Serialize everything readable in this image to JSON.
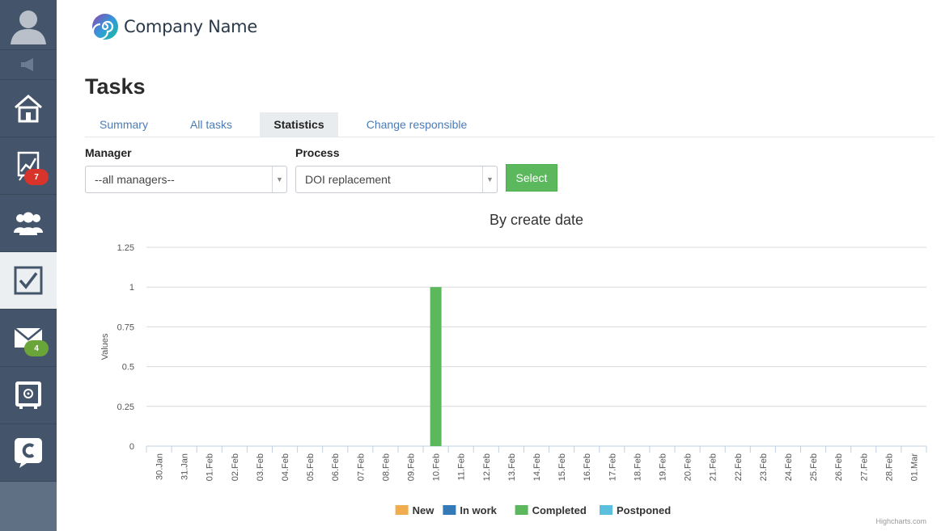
{
  "sidebar": {
    "items": [
      {
        "name": "profile",
        "icon": "user-avatar-icon"
      },
      {
        "name": "announcements",
        "icon": "megaphone-icon"
      },
      {
        "name": "home",
        "icon": "home-icon"
      },
      {
        "name": "sales",
        "icon": "chart-growth-icon",
        "badge": "7",
        "badge_color": "#d9342b"
      },
      {
        "name": "clients",
        "icon": "users-group-icon"
      },
      {
        "name": "tasks",
        "icon": "checkbox-icon",
        "active": true
      },
      {
        "name": "mail",
        "icon": "envelope-icon",
        "badge": "4",
        "badge_color": "#6aa53a"
      },
      {
        "name": "safe",
        "icon": "safe-icon"
      },
      {
        "name": "chat",
        "icon": "chat-c-icon"
      }
    ]
  },
  "header": {
    "company_name": "Company Name",
    "logo_icon": "spiral-logo-icon"
  },
  "page": {
    "title": "Tasks"
  },
  "tabs": [
    {
      "label": "Summary"
    },
    {
      "label": "All tasks"
    },
    {
      "label": "Statistics",
      "active": true
    },
    {
      "label": "Change responsible"
    }
  ],
  "filters": {
    "manager_label": "Manager",
    "manager_value": "--all managers--",
    "process_label": "Process",
    "process_value": "DOI replacement",
    "select_button": "Select"
  },
  "chart_data": {
    "type": "bar",
    "title": "By create date",
    "ylabel": "Values",
    "xlabel": "",
    "ylim": [
      0,
      1.25
    ],
    "yticks": [
      "0",
      "0.25",
      "0.5",
      "0.75",
      "1",
      "1.25"
    ],
    "categories": [
      "30.Jan",
      "31.Jan",
      "01.Feb",
      "02.Feb",
      "03.Feb",
      "04.Feb",
      "05.Feb",
      "06.Feb",
      "07.Feb",
      "08.Feb",
      "09.Feb",
      "10.Feb",
      "11.Feb",
      "12.Feb",
      "13.Feb",
      "14.Feb",
      "15.Feb",
      "16.Feb",
      "17.Feb",
      "18.Feb",
      "19.Feb",
      "20.Feb",
      "21.Feb",
      "22.Feb",
      "23.Feb",
      "24.Feb",
      "25.Feb",
      "26.Feb",
      "27.Feb",
      "28.Feb",
      "01.Mar"
    ],
    "series": [
      {
        "name": "New",
        "color": "#f0ad4e",
        "values": [
          0,
          0,
          0,
          0,
          0,
          0,
          0,
          0,
          0,
          0,
          0,
          0,
          0,
          0,
          0,
          0,
          0,
          0,
          0,
          0,
          0,
          0,
          0,
          0,
          0,
          0,
          0,
          0,
          0,
          0,
          0
        ]
      },
      {
        "name": "In work",
        "color": "#337ab7",
        "values": [
          0,
          0,
          0,
          0,
          0,
          0,
          0,
          0,
          0,
          0,
          0,
          0,
          0,
          0,
          0,
          0,
          0,
          0,
          0,
          0,
          0,
          0,
          0,
          0,
          0,
          0,
          0,
          0,
          0,
          0,
          0
        ]
      },
      {
        "name": "Completed",
        "color": "#5cb85c",
        "values": [
          0,
          0,
          0,
          0,
          0,
          0,
          0,
          0,
          0,
          0,
          0,
          1,
          0,
          0,
          0,
          0,
          0,
          0,
          0,
          0,
          0,
          0,
          0,
          0,
          0,
          0,
          0,
          0,
          0,
          0,
          0
        ]
      },
      {
        "name": "Postponed",
        "color": "#5bc0de",
        "values": [
          0,
          0,
          0,
          0,
          0,
          0,
          0,
          0,
          0,
          0,
          0,
          0,
          0,
          0,
          0,
          0,
          0,
          0,
          0,
          0,
          0,
          0,
          0,
          0,
          0,
          0,
          0,
          0,
          0,
          0,
          0
        ]
      }
    ],
    "legend_position": "bottom-center",
    "grid": true
  },
  "credits": "Highcharts.com"
}
